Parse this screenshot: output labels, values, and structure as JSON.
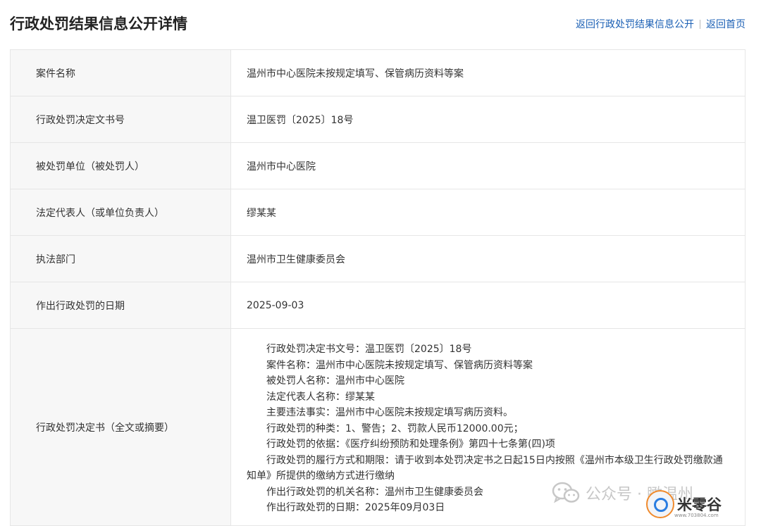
{
  "header": {
    "title": "行政处罚结果信息公开详情",
    "links": {
      "back_list": "返回行政处罚结果信息公开",
      "back_home": "返回首页"
    }
  },
  "rows": [
    {
      "label": "案件名称",
      "value": "温州市中心医院未按规定填写、保管病历资料等案"
    },
    {
      "label": "行政处罚决定文书号",
      "value": "温卫医罚〔2025〕18号"
    },
    {
      "label": "被处罚单位（被处罚人）",
      "value": "温州市中心医院"
    },
    {
      "label": "法定代表人（或单位负责人）",
      "value": "缪某某"
    },
    {
      "label": "执法部门",
      "value": "温州市卫生健康委员会"
    },
    {
      "label": "作出行政处罚的日期",
      "value": "2025-09-03"
    }
  ],
  "decision": {
    "label": "行政处罚决定书（全文或摘要）",
    "lines": [
      "行政处罚决定书文号：温卫医罚〔2025〕18号",
      "案件名称：温州市中心医院未按规定填写、保管病历资料等案",
      "被处罚人名称：温州市中心医院",
      "法定代表人名称：缪某某",
      "主要违法事实：温州市中心医院未按规定填写病历资料。",
      "行政处罚的种类：1、警告；2、罚款人民币12000.00元；",
      "行政处罚的依据：《医疗纠纷预防和处理条例》第四十七条第(四)项",
      "行政处罚的履行方式和期限：请于收到本处罚决定书之日起15日内按照《温州市本级卫生行政处罚缴款通知单》所提供的缴纳方式进行缴纳",
      "作出行政处罚的机关名称：温州市卫生健康委员会",
      "作出行政处罚的日期：2025年09月03日"
    ]
  },
  "watermark": {
    "text": "公众号 · 瞰温州",
    "icon": "wechat-icon"
  },
  "logo": {
    "label": "米零谷",
    "url": "www.703804.com",
    "icon": "circle-logo-icon"
  },
  "colors": {
    "link": "#1a5fb4",
    "label_bg": "#f7f7f7",
    "border": "#e6e6e6",
    "title": "#222222"
  }
}
